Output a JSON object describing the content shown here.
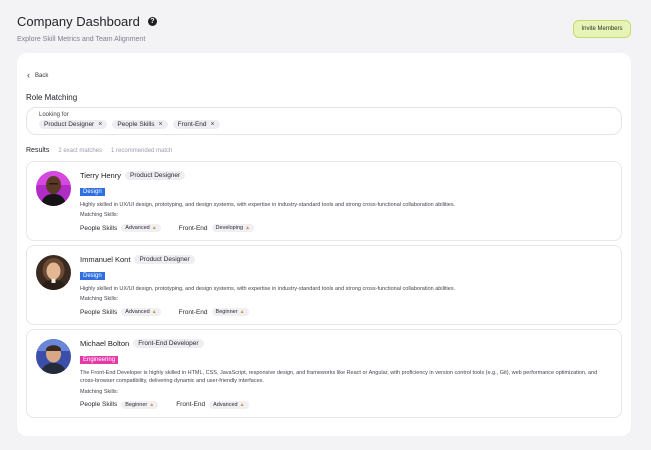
{
  "header": {
    "title": "Company Dashboard",
    "help_icon_glyph": "?",
    "subtitle": "Explore Skill Metrics and Team Alignment",
    "invite_label": "Invite Members"
  },
  "nav": {
    "back_label": "Back"
  },
  "role_matching": {
    "title": "Role Matching",
    "looking_for_label": "Looking for",
    "chips": [
      "Product Designer",
      "People Skills",
      "Front-End"
    ]
  },
  "results": {
    "label": "Results",
    "exact": "2 exact matches",
    "recommended": "1 recommended match"
  },
  "candidates": [
    {
      "name": "Tierry Henry",
      "role": "Product Designer",
      "department": "Design",
      "bio": "Highly skilled in UX/UI design, prototyping, and design systems, with expertise in industry-standard tools and strong cross-functional collaboration abilities.",
      "matching_label": "Matching Skills:",
      "skills": [
        {
          "name": "People Skills",
          "level": "Advanced"
        },
        {
          "name": "Front-End",
          "level": "Developing"
        }
      ]
    },
    {
      "name": "Immanuel Kont",
      "role": "Product Designer",
      "department": "Design",
      "bio": "Highly skilled in UX/UI design, prototyping, and design systems, with expertise in industry-standard tools and strong cross-functional collaboration abilities.",
      "matching_label": "Matching Skills:",
      "skills": [
        {
          "name": "People Skills",
          "level": "Advanced"
        },
        {
          "name": "Front-End",
          "level": "Beginner"
        }
      ]
    },
    {
      "name": "Michael Bolton",
      "role": "Front-End Developer",
      "department": "Engineering",
      "bio": "The Front-End Developer is highly skilled in HTML, CSS, JavaScript, responsive design, and frameworks like React or Angular, with proficiency in version control tools (e.g., Git), web performance optimization, and cross-browser compatibility, delivering dynamic and user-friendly interfaces.",
      "matching_label": "Matching Skills:",
      "skills": [
        {
          "name": "People Skills",
          "level": "Beginner"
        },
        {
          "name": "Front-End",
          "level": "Advanced"
        }
      ]
    }
  ],
  "icons": {
    "back": "chevron-left-icon",
    "remove": "close-icon",
    "level": "level-icon"
  },
  "colors": {
    "invite_bg": "#e6f5b7",
    "design_badge": "#2f6fe0",
    "engineering_badge": "#e43aa7"
  }
}
